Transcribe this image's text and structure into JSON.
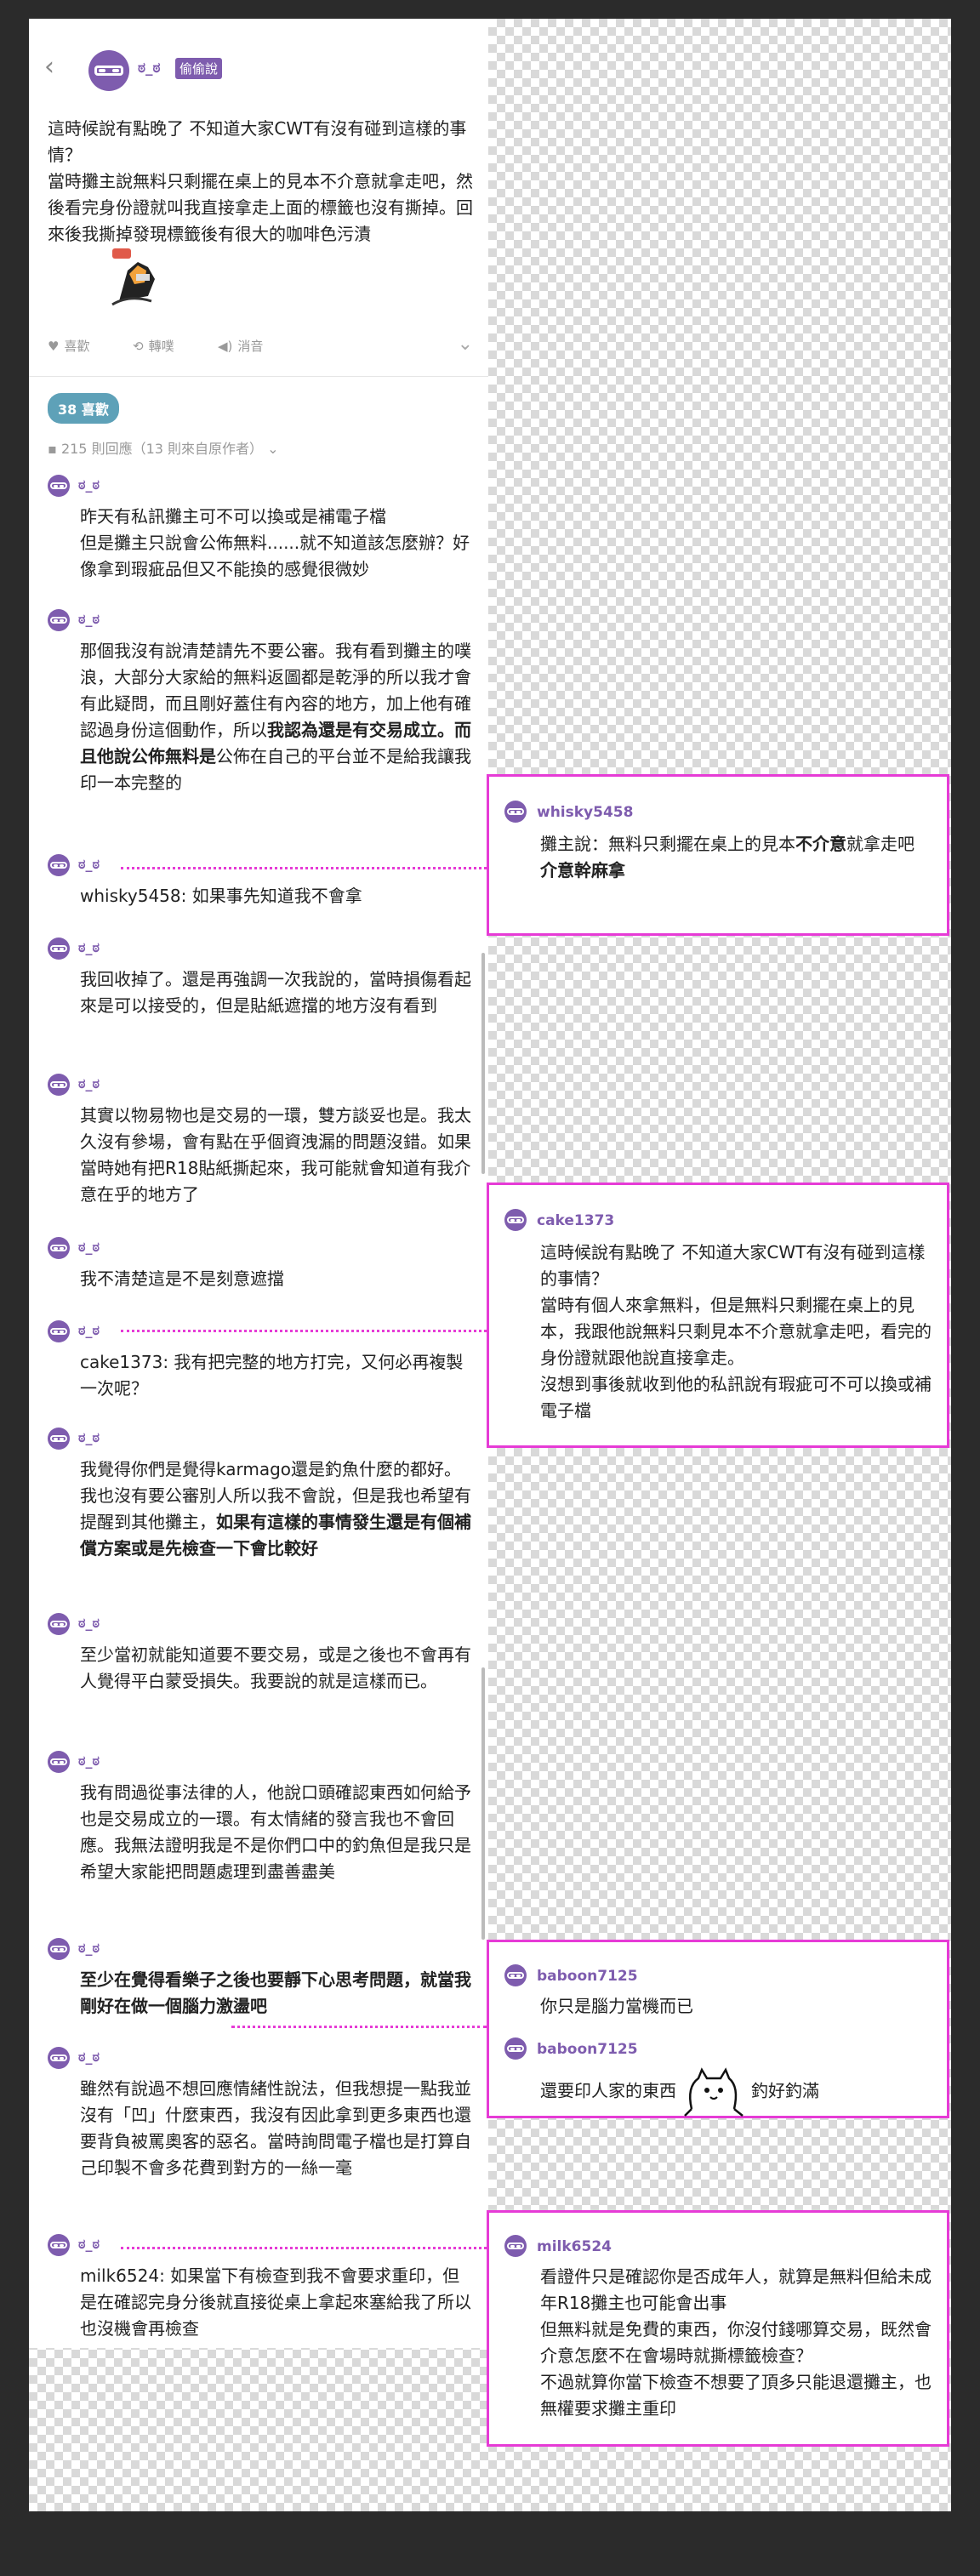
{
  "op": {
    "name": "ಠ_ಠ",
    "badge": "偷偷說",
    "body": "這時候說有點晚了 不知道大家CWT有沒有碰到這樣的事情？\n當時攤主說無料只剩擺在桌上的見本不介意就拿走吧，然後看完身份證就叫我直接拿走上面的標籤也沒有撕掉。回來後我撕掉發現標籤後有很大的咖啡色污漬",
    "sticker_icon": "fox-sticker-icon"
  },
  "actions": {
    "like": "喜歡",
    "repost": "轉噗",
    "mute": "消音"
  },
  "likes": "38 喜歡",
  "reply_count": "215 則回應（13 則來自原作者）",
  "comments": [
    {
      "name": "ಠ_ಠ",
      "text": "昨天有私訊攤主可不可以換或是補電子檔\n但是攤主只說會公佈無料......就不知道該怎麼辦？好像拿到瑕疵品但又不能換的感覺很微妙"
    },
    {
      "name": "ಠ_ಠ",
      "text1": "那個我沒有說清楚請先不要公審。我有看到攤主的噗浪，大部分大家給的無料返圖都是乾淨的所以我才會有此疑問，而且剛好蓋住有內容的地方，加上他有確認過身份這個動作，所以",
      "bold": "我認為還是有交易成立。而且他說公佈無料是",
      "text2": "公佈在自己的平台並不是給我讓我印一本完整的"
    },
    {
      "name": "ಠ_ಠ",
      "text": "whisky5458: 如果事先知道我不會拿"
    },
    {
      "name": "ಠ_ಠ",
      "text": "我回收掉了。還是再強調一次我說的，當時損傷看起來是可以接受的，但是貼紙遮擋的地方沒有看到"
    },
    {
      "name": "ಠ_ಠ",
      "text": "其實以物易物也是交易的一環，雙方談妥也是。我太久沒有參場，會有點在乎個資洩漏的問題沒錯。如果當時她有把R18貼紙撕起來，我可能就會知道有我介意在乎的地方了"
    },
    {
      "name": "ಠ_ಠ",
      "text": "我不清楚這是不是刻意遮擋"
    },
    {
      "name": "ಠ_ಠ",
      "text": "cake1373: 我有把完整的地方打完，又何必再複製一次呢？"
    },
    {
      "name": "ಠ_ಠ",
      "text1": "我覺得你們是覺得karmago還是釣魚什麼的都好。我也沒有要公審別人所以我不會說，但是我也希望有提醒到其他攤主，",
      "bold": "如果有這樣的事情發生還是有個補償方案或是先檢查一下會比較好"
    },
    {
      "name": "ಠ_ಠ",
      "text": "至少當初就能知道要不要交易，或是之後也不會再有人覺得平白蒙受損失。我要說的就是這樣而已。"
    },
    {
      "name": "ಠ_ಠ",
      "text": "我有問過從事法律的人，他說口頭確認東西如何給予也是交易成立的一環。有太情緒的發言我也不會回應。我無法證明我是不是你們口中的釣魚但是我只是希望大家能把問題處理到盡善盡美"
    },
    {
      "name": "ಠ_ಠ",
      "bold": "至少在覺得看樂子之後也要靜下心思考問題，就當我剛好在做一個腦力激盪吧"
    },
    {
      "name": "ಠ_ಠ",
      "text": "雖然有說過不想回應情緒性說法，但我想提一點我並沒有「凹」什麼東西，我沒有因此拿到更多東西也還要背負被罵奧客的惡名。當時詢問電子檔也是打算自己印製不會多花費到對方的一絲一毫"
    },
    {
      "name": "ಠ_ಠ",
      "text": "milk6524: 如果當下有檢查到我不會要求重印，但是在確認完身分後就直接從桌上拿起來塞給我了所以也沒機會再檢查"
    }
  ],
  "notes": [
    {
      "name": "whisky5458",
      "t1": "攤主說：無料只剩擺在桌上的見本",
      "b1": "不介意",
      "t2": "就拿走吧",
      "b2": "介意幹麻拿"
    },
    {
      "name": "cake1373",
      "text": "這時候說有點晚了 不知道大家CWT有沒有碰到這樣的事情？\n當時有個人來拿無料，但是無料只剩擺在桌上的見本，我跟他說無料只剩見本不介意就拿走吧，看完的身份證就跟他說直接拿走。\n沒想到事後就收到他的私訊說有瑕疵可不可以換或補電子檔"
    },
    {
      "name": "baboon7125",
      "text": "你只是腦力當機而已"
    },
    {
      "name": "baboon7125",
      "text": "還要印人家的東西",
      "after": "釣好釣滿",
      "sticker_icon": "cat-sticker-icon"
    },
    {
      "name": "milk6524",
      "text": "看證件只是確認你是否成年人，就算是無料但給未成年R18攤主也可能會出事\n但無料就是免費的東西，你沒付錢哪算交易，既然會介意怎麼不在會場時就撕標籤檢查？\n不過就算你當下檢查不想要了頂多只能退還攤主，也無權要求攤主重印"
    }
  ]
}
